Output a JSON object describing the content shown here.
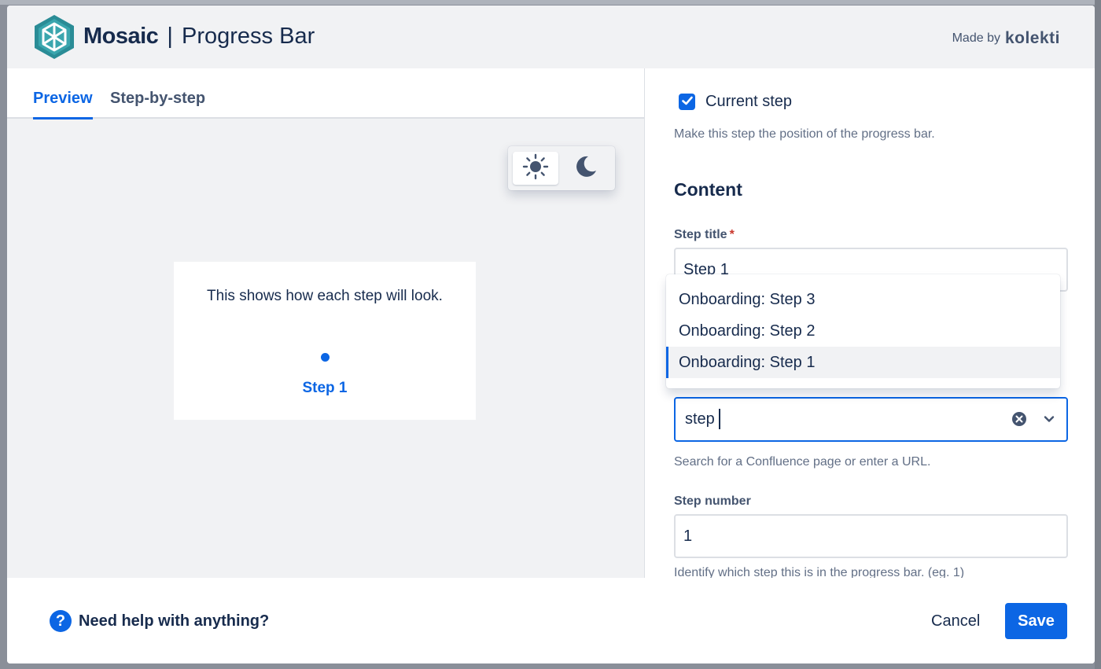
{
  "header": {
    "brand_strong": "Mosaic",
    "brand_separator": "|",
    "brand_light": "Progress Bar",
    "made_by_label": "Made by",
    "made_by_company": "kolekti",
    "logo_icon": "mosaic-hexagon-logo"
  },
  "tabs": [
    {
      "label": "Preview",
      "active": true
    },
    {
      "label": "Step-by-step",
      "active": false
    }
  ],
  "theme_toggle": {
    "light_icon": "sun-icon",
    "dark_icon": "moon-icon",
    "selected": "light"
  },
  "preview": {
    "message": "This shows how each step will look.",
    "step_label": "Step 1"
  },
  "form": {
    "current_step": {
      "checked": true,
      "label": "Current step",
      "helper": "Make this step the position of the progress bar."
    },
    "section_title": "Content",
    "step_title": {
      "label": "Step title",
      "required_marker": "*",
      "value": "Step 1"
    },
    "destination": {
      "value": "step",
      "helper": "Search for a Confluence page or enter a URL.",
      "options": [
        {
          "label": "Onboarding: Step 3",
          "selected": false
        },
        {
          "label": "Onboarding: Step 2",
          "selected": false
        },
        {
          "label": "Onboarding: Step 1",
          "selected": true
        }
      ]
    },
    "step_number": {
      "label": "Step number",
      "value": "1",
      "helper": "Identify which step this is in the progress bar. (eg. 1)"
    }
  },
  "footer": {
    "help_text": "Need help with anything?",
    "cancel_label": "Cancel",
    "save_label": "Save"
  },
  "colors": {
    "accent": "#0c66e4",
    "text": "#172b4d",
    "subtle_text": "#626f86",
    "surface": "#f1f2f4",
    "required": "#c9372c"
  }
}
